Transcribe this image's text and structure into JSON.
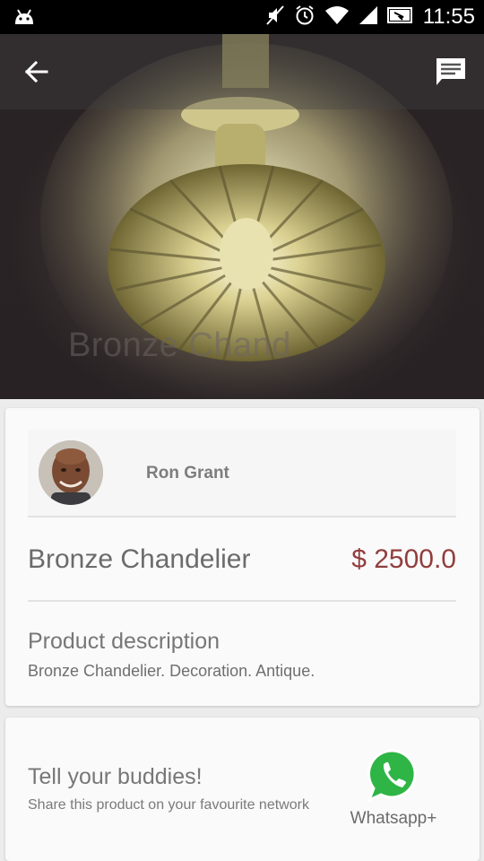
{
  "status_bar": {
    "time": "11:55",
    "icons": [
      "android-icon",
      "mute-icon",
      "alarm-icon",
      "wifi-icon",
      "signal-icon",
      "battery-icon"
    ]
  },
  "hero": {
    "watermark_text": "Bronze Chand",
    "icons": [
      "back-arrow-icon",
      "chat-icon"
    ]
  },
  "seller": {
    "name": "Ron Grant"
  },
  "product": {
    "title": "Bronze Chandelier",
    "price": "$ 2500.0",
    "description_heading": "Product description",
    "description": "Bronze Chandelier. Decoration. Antique."
  },
  "share": {
    "heading": "Tell your buddies!",
    "subtitle": "Share this product on your favourite network",
    "whatsapp_label": "Whatsapp+"
  },
  "colors": {
    "price": "#923d3d",
    "whatsapp_green": "#2fb545",
    "card_bg": "#fafafa",
    "page_bg": "#ececec"
  }
}
